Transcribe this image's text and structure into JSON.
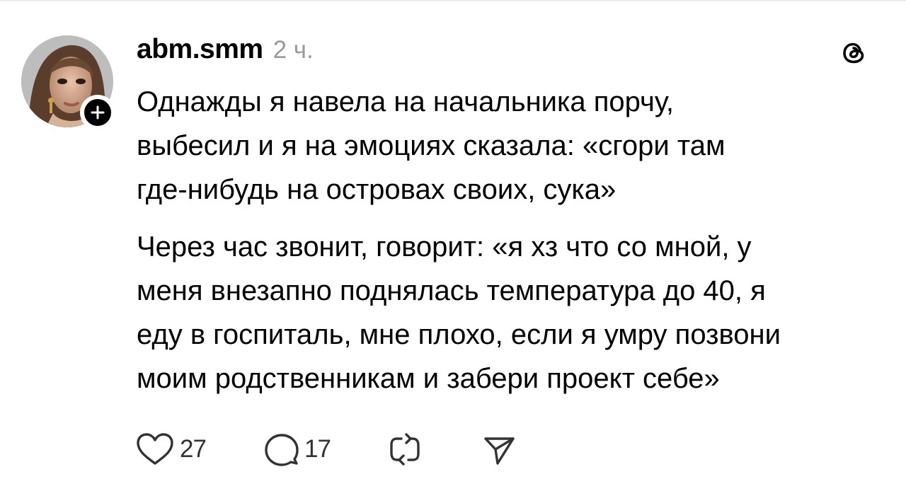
{
  "post": {
    "username": "abm.smm",
    "timestamp": "2 ч.",
    "paragraphs": [
      "Однажды я навела на начальника порчу,\nвыбесил и я на эмоциях сказала: «сгори там\nгде-нибудь на островах своих, сука»",
      "Через час звонит, говорит: «я хз что со мной, у\nменя внезапно поднялась температура до 40, я\nеду в госпиталь, мне плохо, если я умру позвони\nмоим родственникам и забери проект себе»"
    ],
    "likes": "27",
    "replies": "17"
  },
  "icons": {
    "like": "heart-icon",
    "reply": "comment-icon",
    "repost": "repost-icon",
    "share": "share-icon",
    "follow": "plus-icon",
    "brand": "threads-logo-icon"
  },
  "colors": {
    "text": "#000000",
    "muted": "#999999",
    "icon": "#333333",
    "badge": "#000000"
  }
}
